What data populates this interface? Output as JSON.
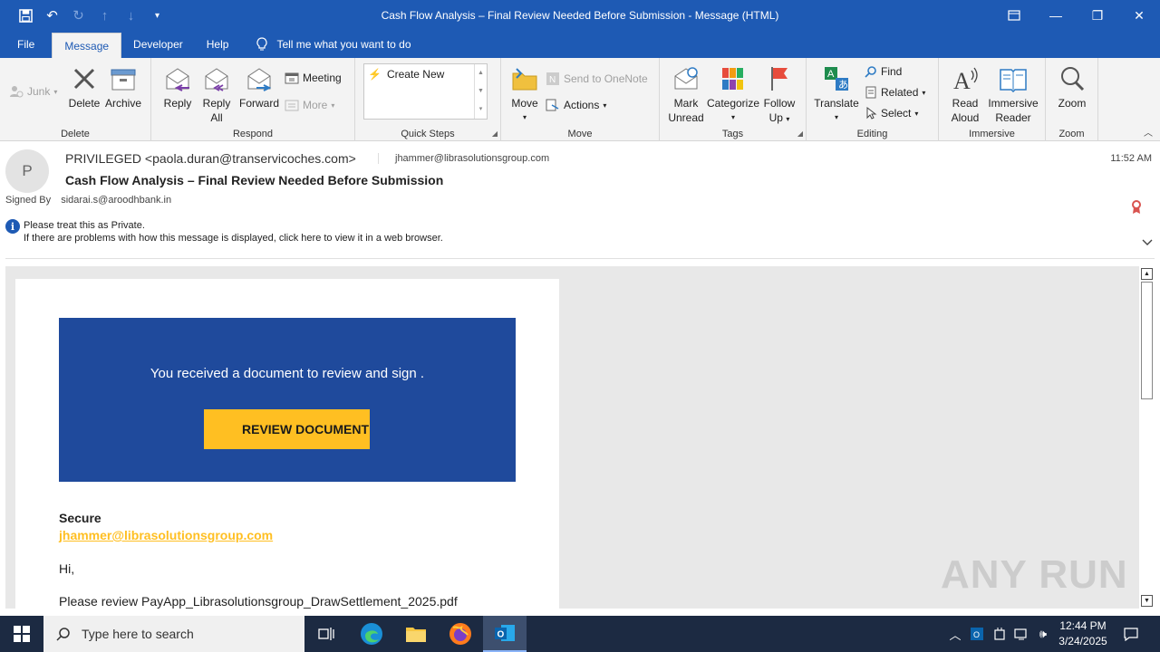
{
  "window": {
    "title": "Cash Flow Analysis – Final Review Needed Before Submission  -  Message (HTML)"
  },
  "menu": {
    "tabs": [
      "File",
      "Message",
      "Developer",
      "Help"
    ],
    "active_tab": "Message",
    "tell_me": "Tell me what you want to do"
  },
  "ribbon": {
    "delete_group": {
      "label": "Delete",
      "junk": "Junk",
      "delete": "Delete",
      "archive": "Archive"
    },
    "respond_group": {
      "label": "Respond",
      "reply": "Reply",
      "reply_all_1": "Reply",
      "reply_all_2": "All",
      "forward": "Forward",
      "meeting": "Meeting",
      "more": "More"
    },
    "quick_steps_group": {
      "label": "Quick Steps",
      "create_new": "Create New"
    },
    "move_group": {
      "label": "Move",
      "move": "Move",
      "send_onenote": "Send to OneNote",
      "actions": "Actions"
    },
    "tags_group": {
      "label": "Tags",
      "mark_unread_1": "Mark",
      "mark_unread_2": "Unread",
      "categorize": "Categorize",
      "follow_up_1": "Follow",
      "follow_up_2": "Up"
    },
    "editing_group": {
      "label": "Editing",
      "translate": "Translate",
      "find": "Find",
      "related": "Related",
      "select": "Select"
    },
    "immersive_group": {
      "label": "Immersive",
      "read_aloud_1": "Read",
      "read_aloud_2": "Aloud",
      "immersive_reader_1": "Immersive",
      "immersive_reader_2": "Reader"
    },
    "zoom_group": {
      "label": "Zoom",
      "zoom": "Zoom"
    }
  },
  "message": {
    "avatar_letter": "P",
    "from": "PRIVILEGED <paola.duran@transervicoches.com>",
    "to": "jhammer@librasolutionsgroup.com",
    "time": "11:52 AM",
    "subject": "Cash Flow Analysis – Final Review Needed Before Submission",
    "signed_by_label": "Signed By",
    "signed_by": "sidarai.s@aroodhbank.in",
    "info_line1": "Please treat this as Private.",
    "info_line2": "If there are problems with how this message is displayed, click here to view it in a web browser."
  },
  "email_body": {
    "banner_text": "You received a document to review and sign .",
    "cta": "REVIEW DOCUMENT",
    "secure": "Secure",
    "link": "jhammer@librasolutionsgroup.com",
    "greeting": "Hi,",
    "please": "Please  review PayApp_Librasolutionsgroup_DrawSettlement_2025.pdf"
  },
  "watermark": "ANY RUN",
  "taskbar": {
    "search_placeholder": "Type here to search",
    "time": "12:44 PM",
    "date": "3/24/2025"
  },
  "colors": {
    "accent": "#1e5ab4",
    "banner": "#1f4a9c",
    "cta": "#ffbf22",
    "taskbar": "#1c2a42"
  }
}
